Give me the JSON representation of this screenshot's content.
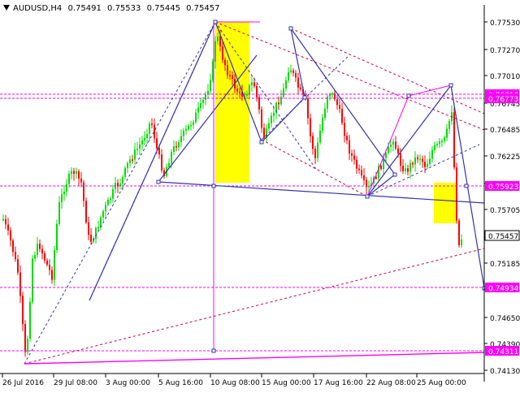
{
  "chart_data": {
    "type": "candlestick",
    "title": "AUDUSD,H4",
    "ohlc_header": {
      "open": "0.75491",
      "high": "0.75533",
      "low": "0.75445",
      "close": "0.75457"
    },
    "current_price_label": "0.75457",
    "ylim": [
      0.7413,
      0.7775
    ],
    "y_ticks": [
      "0.77530",
      "0.77270",
      "0.77010",
      "0.76745",
      "0.76485",
      "0.76225",
      "0.75965",
      "0.75705",
      "0.75445",
      "0.75185",
      "0.74925",
      "0.74650",
      "0.74390",
      "0.74130"
    ],
    "x_ticks": [
      "26 Jul 2016",
      "29 Jul 08:00",
      "3 Aug 00:00",
      "5 Aug 16:00",
      "10 Aug 08:00",
      "15 Aug 00:00",
      "17 Aug 16:00",
      "22 Aug 08:00",
      "25 Aug 00:00"
    ],
    "level_labels": [
      "0.76816",
      "0.76773",
      "0.75923",
      "0.74934",
      "0.74311"
    ],
    "grid": false,
    "colors": {
      "bull": "#00dd00",
      "bear": "#ff0000",
      "projection": "#3333aa",
      "dotted_line": "#cc0044",
      "pink": "#ff00ff",
      "highlight": "#ffff00",
      "label_bg": "#ff00ff",
      "price_bg": "#ffffff"
    }
  }
}
